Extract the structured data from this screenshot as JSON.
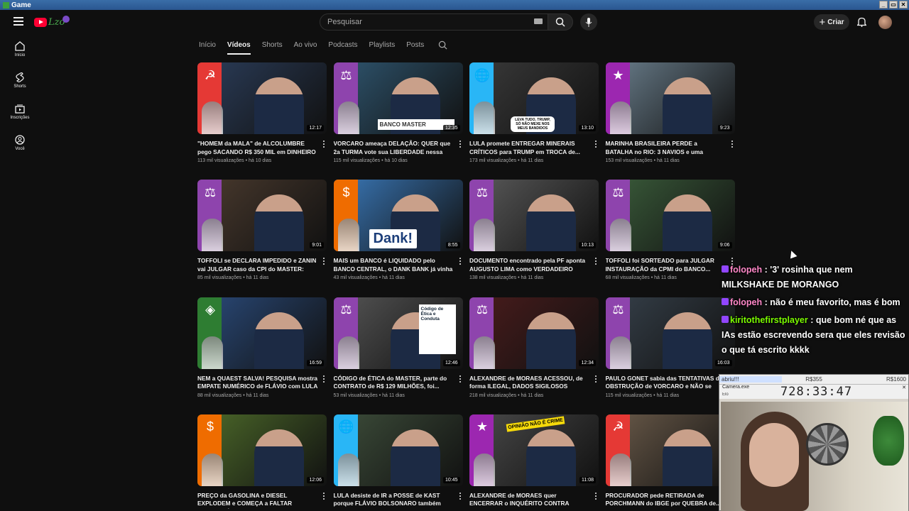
{
  "window": {
    "title": "Game",
    "buttons": [
      "_",
      "▭",
      "✕"
    ]
  },
  "header": {
    "search_placeholder": "Pesquisar",
    "create_label": "Criar"
  },
  "sidebar": {
    "items": [
      {
        "label": "Início",
        "icon": "home-icon"
      },
      {
        "label": "Shorts",
        "icon": "shorts-icon"
      },
      {
        "label": "Inscrições",
        "icon": "subscriptions-icon"
      },
      {
        "label": "Você",
        "icon": "you-icon"
      }
    ]
  },
  "tabs": [
    "Início",
    "Vídeos",
    "Shorts",
    "Ao vivo",
    "Podcasts",
    "Playlists",
    "Posts"
  ],
  "active_tab": "Vídeos",
  "videos": [
    {
      "title": "\"HOMEM da MALA\" de ALCOLUMBRE pego SACANDO R$ 350 MIL em DINHEIRO VIVO ...",
      "meta": "113 mil visualizações • há 10 dias",
      "duration": "12:17",
      "symbol": "☭",
      "band": "#e53935"
    },
    {
      "title": "VORCARO ameaça DELAÇÃO: QUER que 2a TURMA vote sua LIBERDADE nessa SEXTA,...",
      "meta": "115 mil visualizações • há 10 dias",
      "duration": "12:35",
      "symbol": "⚖",
      "band": "#8e44ad"
    },
    {
      "title": "LULA promete ENTREGAR MINERAIS CRÍTICOS para TRUMP em TROCA de...",
      "meta": "173 mil visualizações • há 11 dias",
      "duration": "13:10",
      "symbol": "🌐",
      "band": "#29b6f6"
    },
    {
      "title": "MARINHA BRASILEIRA PERDE a BATALHA no RIO: 3 NAVIOS e uma ESCAVADEIRA,...",
      "meta": "153 mil visualizações • há 11 dias",
      "duration": "9:23",
      "symbol": "★",
      "band": "#9c27b0"
    },
    {
      "title": "TOFFOLI se DECLARA IMPEDIDO e ZANIN vai JULGAR caso da CPI do MASTER: MAS...",
      "meta": "85 mil visualizações • há 11 dias",
      "duration": "9:01",
      "symbol": "⚖",
      "band": "#8e44ad"
    },
    {
      "title": "MAIS um BANCO é LIQUIDADO pelo BANCO CENTRAL, o DANK BANK já vinha MAL,...",
      "meta": "43 mil visualizações • há 11 dias",
      "duration": "8:55",
      "symbol": "$",
      "band": "#ef6c00"
    },
    {
      "title": "DOCUMENTO encontrado pela PF aponta AUGUSTO LIMA como VERDADEIRO DONO...",
      "meta": "138 mil visualizações • há 11 dias",
      "duration": "10:13",
      "symbol": "⚖",
      "band": "#8e44ad"
    },
    {
      "title": "TOFFOLI foi SORTEADO para JULGAR INSTAURAÇÃO da CPMI do BANCO...",
      "meta": "68 mil visualizações • há 11 dias",
      "duration": "9:06",
      "symbol": "⚖",
      "band": "#8e44ad"
    },
    {
      "title": "NEM a QUAEST SALVA! PESQUISA mostra EMPATE NUMÉRICO de FLÁVIO com LULA ...",
      "meta": "88 mil visualizações • há 11 dias",
      "duration": "16:59",
      "symbol": "◈",
      "band": "#2e7d32"
    },
    {
      "title": "CÓDIGO de ÉTICA do MASTER, parte do CONTRATO de R$ 129 MILHÕES, foi...",
      "meta": "53 mil visualizações • há 11 dias",
      "duration": "12:46",
      "symbol": "⚖",
      "band": "#8e44ad"
    },
    {
      "title": "ALEXANDRE de MORAES ACESSOU, de forma ILEGAL, DADOS SIGILOSOS sobre...",
      "meta": "218 mil visualizações • há 11 dias",
      "duration": "12:34",
      "symbol": "⚖",
      "band": "#8e44ad"
    },
    {
      "title": "PAULO GONET sabia das TENTATIVAS de OBSTRUÇÃO de VORCARO e NÃO se OPO...",
      "meta": "115 mil visualizações • há 11 dias",
      "duration": "16:03",
      "symbol": "⚖",
      "band": "#8e44ad"
    },
    {
      "title": "PREÇO da GASOLINA e DIESEL EXPLODEM e COMEÇA a FALTAR COMBUSTÍVEL em...",
      "meta": "",
      "duration": "12:06",
      "symbol": "$",
      "band": "#ef6c00"
    },
    {
      "title": "LULA desiste de IR a POSSE de KAST porque FLÁVIO BOLSONARO também FOI...",
      "meta": "",
      "duration": "10:45",
      "symbol": "🌐",
      "band": "#29b6f6"
    },
    {
      "title": "ALEXANDRE de MORAES quer ENCERRAR o INQUÉRITO CONTRA MONARK, isso depois...",
      "meta": "",
      "duration": "11:08",
      "symbol": "★",
      "band": "#9c27b0"
    },
    {
      "title": "PROCURADOR pede RETIRADA de PORCHMANN do IBGE por QUEBRA de...",
      "meta": "",
      "duration": "",
      "symbol": "☭",
      "band": "#e53935"
    }
  ],
  "thumb_captions": {
    "v3": "LEVA TUDO, TRUMP, SÓ NÃO MEXE NOS MEUS BANDIDOS",
    "v2": "BANCO MASTER",
    "v6": "Dank!",
    "v10": "Código de Ética e Conduta",
    "v15": "OPINIÃO NÃO É CRIME"
  },
  "chat": [
    {
      "user": "folopeh",
      "text": ": '3' rosinha que nem MILKSHAKE DE MORANGO"
    },
    {
      "user": "folopeh",
      "text": ": não é meu favorito, mas é bom"
    },
    {
      "user": "kiritothefirstplayer",
      "text": ": que bom né que as IAs estão escrevendo sera que eles revisão o que tá escrito kkkk"
    }
  ],
  "camera": {
    "tab1": "abriu!!!",
    "tab2": "R$355",
    "tab3": "R$1600",
    "window_title": "Camera.exe",
    "sub": "Elo",
    "timer": "728:33:47"
  }
}
